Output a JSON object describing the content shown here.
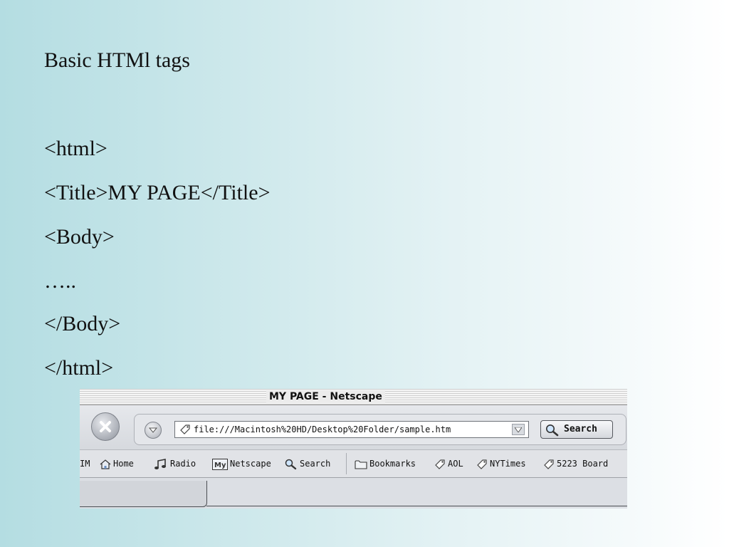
{
  "slide": {
    "title": "Basic HTMl tags",
    "code_lines": [
      "<html>",
      "<Title>MY PAGE</Title>",
      "<Body>",
      "…..",
      "</Body>",
      "</html>"
    ]
  },
  "browser": {
    "window_title": "MY PAGE - Netscape",
    "url": "file:///Macintosh%20HD/Desktop%20Folder/sample.htm",
    "search_label": "Search",
    "personal_toolbar": [
      {
        "label": "IM",
        "icon": "none"
      },
      {
        "label": "Home",
        "icon": "home-icon"
      },
      {
        "label": "Radio",
        "icon": "radio-icon"
      },
      {
        "label": "Netscape",
        "icon": "my-netscape-icon"
      },
      {
        "label": "Search",
        "icon": "search-icon"
      },
      {
        "label": "Bookmarks",
        "icon": "folder-icon"
      },
      {
        "label": "AOL",
        "icon": "bookmark-icon"
      },
      {
        "label": "NYTimes",
        "icon": "bookmark-icon"
      },
      {
        "label": "5223 Board",
        "icon": "bookmark-icon"
      }
    ]
  }
}
